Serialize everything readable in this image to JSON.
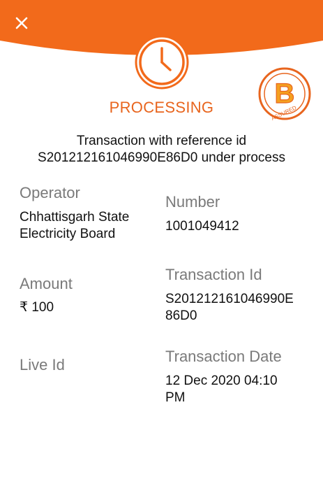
{
  "colors": {
    "accent": "#f26a1b",
    "status": "#e8651e",
    "label": "#7a7a7a"
  },
  "header": {
    "close_icon": "close-icon",
    "status_icon": "clock-icon"
  },
  "badge": {
    "letter": "B",
    "text": "ASSURED"
  },
  "status": {
    "title": "PROCESSING",
    "message_line1": "Transaction with reference id",
    "message_line2": "S201212161046990E86D0 under process"
  },
  "details": {
    "operator": {
      "label": "Operator",
      "value_line1": "Chhattisgarh State",
      "value_line2": "Electricity Board"
    },
    "number": {
      "label": "Number",
      "value": "1001049412"
    },
    "amount": {
      "label": "Amount",
      "value": "₹ 100"
    },
    "transaction_id": {
      "label": "Transaction Id",
      "value_line1": "S201212161046990E",
      "value_line2": "86D0"
    },
    "live_id": {
      "label": "Live Id"
    },
    "transaction_date": {
      "label": "Transaction Date",
      "value_line1": "12 Dec 2020 04:10",
      "value_line2": "PM"
    }
  }
}
